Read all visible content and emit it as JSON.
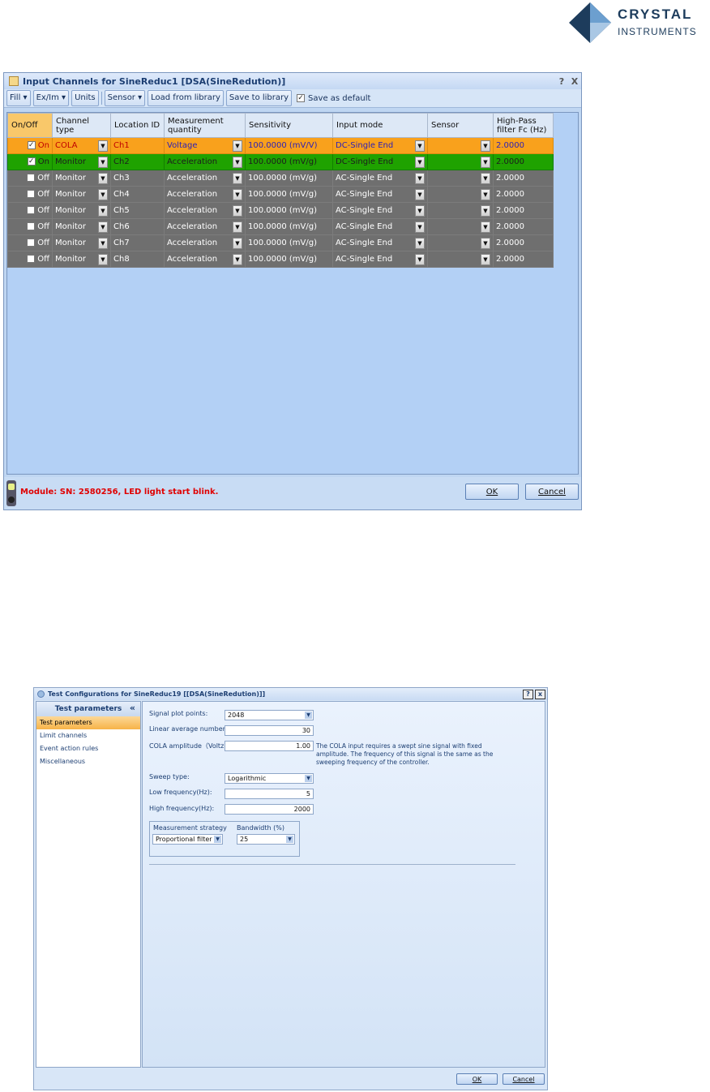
{
  "logo": {
    "line1": "CRYSTAL",
    "line2": "INSTRUMENTS"
  },
  "win1": {
    "title": "Input Channels for SineReduc1 [DSA(SineRedution)]",
    "title_help": "?",
    "title_close": "X",
    "toolbar": {
      "fill": "Fill ▾",
      "exim": "Ex/Im ▾",
      "units": "Units",
      "sensor": "Sensor ▾",
      "load": "Load from library",
      "save": "Save to library",
      "save_default": "Save as default"
    },
    "headers": {
      "onoff": "On/Off",
      "ctype1": "Channel",
      "ctype2": "type",
      "loc": "Location ID",
      "mq1": "Measurement",
      "mq2": "quantity",
      "sens": "Sensitivity",
      "mode": "Input mode",
      "sensor": "Sensor",
      "hp1": "High-Pass",
      "hp2": "filter Fc (Hz)"
    },
    "rows": [
      {
        "on": "On",
        "checked": true,
        "type": "COLA",
        "loc": "Ch1",
        "mq": "Voltage",
        "sens": "100.0000 (mV/V)",
        "mode": "DC-Single End",
        "fc": "2.0000"
      },
      {
        "on": "On",
        "checked": true,
        "type": "Monitor",
        "loc": "Ch2",
        "mq": "Acceleration",
        "sens": "100.0000 (mV/g)",
        "mode": "DC-Single End",
        "fc": "2.0000"
      },
      {
        "on": "Off",
        "checked": false,
        "type": "Monitor",
        "loc": "Ch3",
        "mq": "Acceleration",
        "sens": "100.0000 (mV/g)",
        "mode": "AC-Single End",
        "fc": "2.0000"
      },
      {
        "on": "Off",
        "checked": false,
        "type": "Monitor",
        "loc": "Ch4",
        "mq": "Acceleration",
        "sens": "100.0000 (mV/g)",
        "mode": "AC-Single End",
        "fc": "2.0000"
      },
      {
        "on": "Off",
        "checked": false,
        "type": "Monitor",
        "loc": "Ch5",
        "mq": "Acceleration",
        "sens": "100.0000 (mV/g)",
        "mode": "AC-Single End",
        "fc": "2.0000"
      },
      {
        "on": "Off",
        "checked": false,
        "type": "Monitor",
        "loc": "Ch6",
        "mq": "Acceleration",
        "sens": "100.0000 (mV/g)",
        "mode": "AC-Single End",
        "fc": "2.0000"
      },
      {
        "on": "Off",
        "checked": false,
        "type": "Monitor",
        "loc": "Ch7",
        "mq": "Acceleration",
        "sens": "100.0000 (mV/g)",
        "mode": "AC-Single End",
        "fc": "2.0000"
      },
      {
        "on": "Off",
        "checked": false,
        "type": "Monitor",
        "loc": "Ch8",
        "mq": "Acceleration",
        "sens": "100.0000 (mV/g)",
        "mode": "AC-Single End",
        "fc": "2.0000"
      }
    ],
    "status": "Module: SN: 2580256, LED light start blink.",
    "ok": "OK",
    "cancel": "Cancel"
  },
  "win2": {
    "title": "Test Configurations for SineReduc19 [[DSA(SineRedution)]]",
    "title_help": "?",
    "title_close": "x",
    "sidebar_header": "Test parameters",
    "collapse": "«",
    "sidebar_items": [
      "Test parameters",
      "Limit channels",
      "Event action rules",
      "Miscellaneous"
    ],
    "fields": {
      "spp_label": "Signal plot points:",
      "spp_value": "2048",
      "lan_label": "Linear average number:",
      "lan_value": "30",
      "cola_label": "COLA amplitude（Voltz):",
      "cola_value": "1.00",
      "note": "The COLA input requires a swept sine signal with fixed amplitude. The frequency of this signal is the same as the sweeping frequency of the controller.",
      "sweep_label": "Sweep type:",
      "sweep_value": "Logarithmic",
      "low_label": "Low frequency(Hz):",
      "low_value": "5",
      "high_label": "High frequency(Hz):",
      "high_value": "2000",
      "ms_label": "Measurement strategy",
      "ms_value": "Proportional filter",
      "bw_label": "Bandwidth (%)",
      "bw_value": "25"
    },
    "ok": "OK",
    "cancel": "Cancel"
  }
}
